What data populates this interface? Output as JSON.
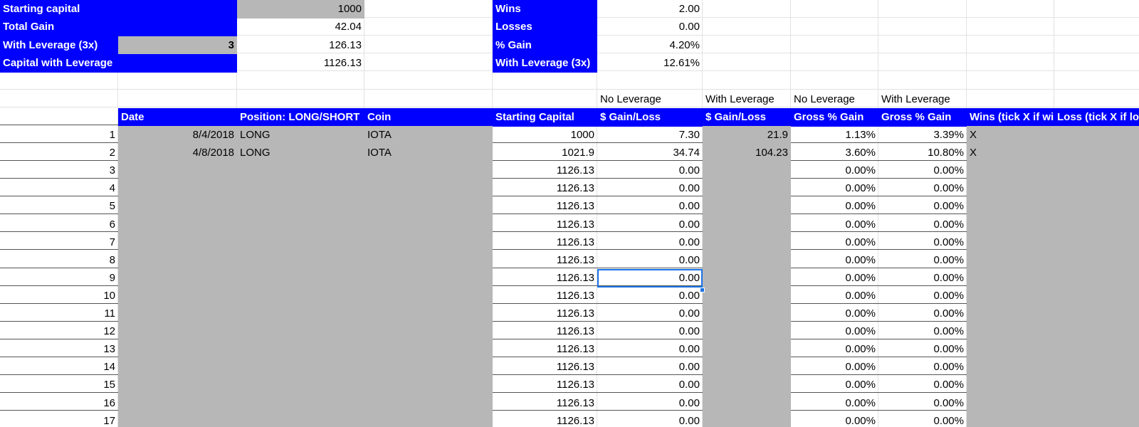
{
  "summary_left": [
    {
      "label": "Starting capital",
      "value": "1000"
    },
    {
      "label": "Total Gain",
      "value": "42.04"
    },
    {
      "label": "With Leverage (3x)",
      "multiplier": "3",
      "value": "126.13"
    },
    {
      "label": "Capital with Leverage",
      "value": "1126.13"
    }
  ],
  "summary_right": [
    {
      "label": "Wins",
      "value": "2.00"
    },
    {
      "label": "Losses",
      "value": "0.00"
    },
    {
      "label": "% Gain",
      "value": "4.20%"
    },
    {
      "label": "With Leverage (3x)",
      "value": "12.61%"
    }
  ],
  "subheaders": [
    "No Leverage",
    "With Leverage",
    "No Leverage",
    "With Leverage"
  ],
  "columns": [
    "Date",
    "Position: LONG/SHORT",
    "Coin",
    "Starting Capital",
    "$ Gain/Loss",
    "$ Gain/Loss",
    "Gross % Gain",
    "Gross % Gain",
    "Wins (tick X if win)",
    "Loss (tick X if loss)"
  ],
  "rows": [
    [
      "1",
      "8/4/2018",
      "LONG",
      "IOTA",
      "1000",
      "7.30",
      "21.9",
      "1.13%",
      "3.39%",
      "X",
      ""
    ],
    [
      "2",
      "4/8/2018",
      "LONG",
      "IOTA",
      "1021.9",
      "34.74",
      "104.23",
      "3.60%",
      "10.80%",
      "X",
      ""
    ],
    [
      "3",
      "",
      "",
      "",
      "1126.13",
      "0.00",
      "",
      "0.00%",
      "0.00%",
      "",
      ""
    ],
    [
      "4",
      "",
      "",
      "",
      "1126.13",
      "0.00",
      "",
      "0.00%",
      "0.00%",
      "",
      ""
    ],
    [
      "5",
      "",
      "",
      "",
      "1126.13",
      "0.00",
      "",
      "0.00%",
      "0.00%",
      "",
      ""
    ],
    [
      "6",
      "",
      "",
      "",
      "1126.13",
      "0.00",
      "",
      "0.00%",
      "0.00%",
      "",
      ""
    ],
    [
      "7",
      "",
      "",
      "",
      "1126.13",
      "0.00",
      "",
      "0.00%",
      "0.00%",
      "",
      ""
    ],
    [
      "8",
      "",
      "",
      "",
      "1126.13",
      "0.00",
      "",
      "0.00%",
      "0.00%",
      "",
      ""
    ],
    [
      "9",
      "",
      "",
      "",
      "1126.13",
      "0.00",
      "",
      "0.00%",
      "0.00%",
      "",
      ""
    ],
    [
      "10",
      "",
      "",
      "",
      "1126.13",
      "0.00",
      "",
      "0.00%",
      "0.00%",
      "",
      ""
    ],
    [
      "11",
      "",
      "",
      "",
      "1126.13",
      "0.00",
      "",
      "0.00%",
      "0.00%",
      "",
      ""
    ],
    [
      "12",
      "",
      "",
      "",
      "1126.13",
      "0.00",
      "",
      "0.00%",
      "0.00%",
      "",
      ""
    ],
    [
      "13",
      "",
      "",
      "",
      "1126.13",
      "0.00",
      "",
      "0.00%",
      "0.00%",
      "",
      ""
    ],
    [
      "14",
      "",
      "",
      "",
      "1126.13",
      "0.00",
      "",
      "0.00%",
      "0.00%",
      "",
      ""
    ],
    [
      "15",
      "",
      "",
      "",
      "1126.13",
      "0.00",
      "",
      "0.00%",
      "0.00%",
      "",
      ""
    ],
    [
      "16",
      "",
      "",
      "",
      "1126.13",
      "0.00",
      "",
      "0.00%",
      "0.00%",
      "",
      ""
    ],
    [
      "17",
      "",
      "",
      "",
      "1126.13",
      "0.00",
      "",
      "0.00%",
      "0.00%",
      "",
      ""
    ]
  ],
  "colors": {
    "header_blue": "#0000ff",
    "input_gray": "#b7b7b7",
    "selection": "#1a73e8",
    "grid": "#e2e2e2"
  }
}
